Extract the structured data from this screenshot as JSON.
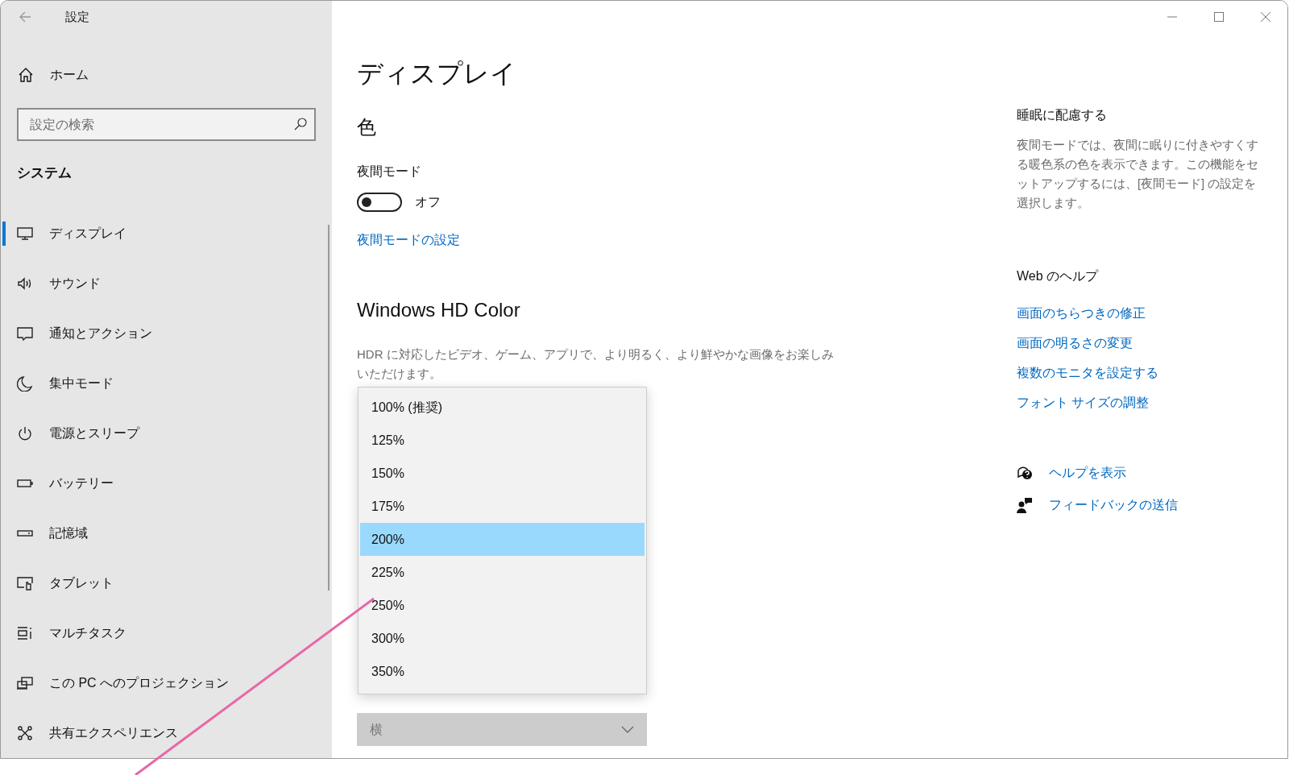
{
  "window": {
    "title": "設定"
  },
  "sidebar": {
    "home": "ホーム",
    "search": {
      "placeholder": "設定の検索"
    },
    "section": "システム",
    "items": [
      {
        "label": "ディスプレイ",
        "kind": "display",
        "selected": true
      },
      {
        "label": "サウンド",
        "kind": "sound",
        "selected": false
      },
      {
        "label": "通知とアクション",
        "kind": "notification",
        "selected": false
      },
      {
        "label": "集中モード",
        "kind": "focus",
        "selected": false
      },
      {
        "label": "電源とスリープ",
        "kind": "power",
        "selected": false
      },
      {
        "label": "バッテリー",
        "kind": "battery",
        "selected": false
      },
      {
        "label": "記憶域",
        "kind": "storage",
        "selected": false
      },
      {
        "label": "タブレット",
        "kind": "tablet",
        "selected": false
      },
      {
        "label": "マルチタスク",
        "kind": "multitask",
        "selected": false
      },
      {
        "label": "この PC へのプロジェクション",
        "kind": "projection",
        "selected": false
      },
      {
        "label": "共有エクスペリエンス",
        "kind": "shared",
        "selected": false
      }
    ]
  },
  "main": {
    "title": "ディスプレイ",
    "color": {
      "heading": "色",
      "night_mode": {
        "label": "夜間モード",
        "on": false,
        "state_text": "オフ"
      },
      "link": "夜間モードの設定"
    },
    "hd_color": {
      "heading": "Windows HD Color",
      "description": "HDR に対応したビデオ、ゲーム、アプリで、より明るく、より鮮やかな画像をお楽しみいただけます。"
    },
    "orientation": {
      "value": "横",
      "disabled": true
    },
    "scale_dropdown": {
      "options": [
        {
          "label": "100% (推奨)",
          "selected": false
        },
        {
          "label": "125%",
          "selected": false
        },
        {
          "label": "150%",
          "selected": false
        },
        {
          "label": "175%",
          "selected": false
        },
        {
          "label": "200%",
          "selected": true
        },
        {
          "label": "225%",
          "selected": false
        },
        {
          "label": "250%",
          "selected": false
        },
        {
          "label": "300%",
          "selected": false
        },
        {
          "label": "350%",
          "selected": false
        }
      ]
    }
  },
  "right_panel": {
    "sleep": {
      "heading": "睡眠に配慮する",
      "text": "夜間モードでは、夜間に眠りに付きやすくする暖色系の色を表示できます。この機能をセットアップするには、[夜間モード] の設定を選択します。"
    },
    "web_help": {
      "heading": "Web のヘルプ",
      "links": [
        "画面のちらつきの修正",
        "画面の明るさの変更",
        "複数のモニタを設定する",
        "フォント サイズの調整"
      ]
    },
    "actions": [
      {
        "kind": "help",
        "label": "ヘルプを表示"
      },
      {
        "kind": "feedback",
        "label": "フィードバックの送信"
      }
    ]
  }
}
